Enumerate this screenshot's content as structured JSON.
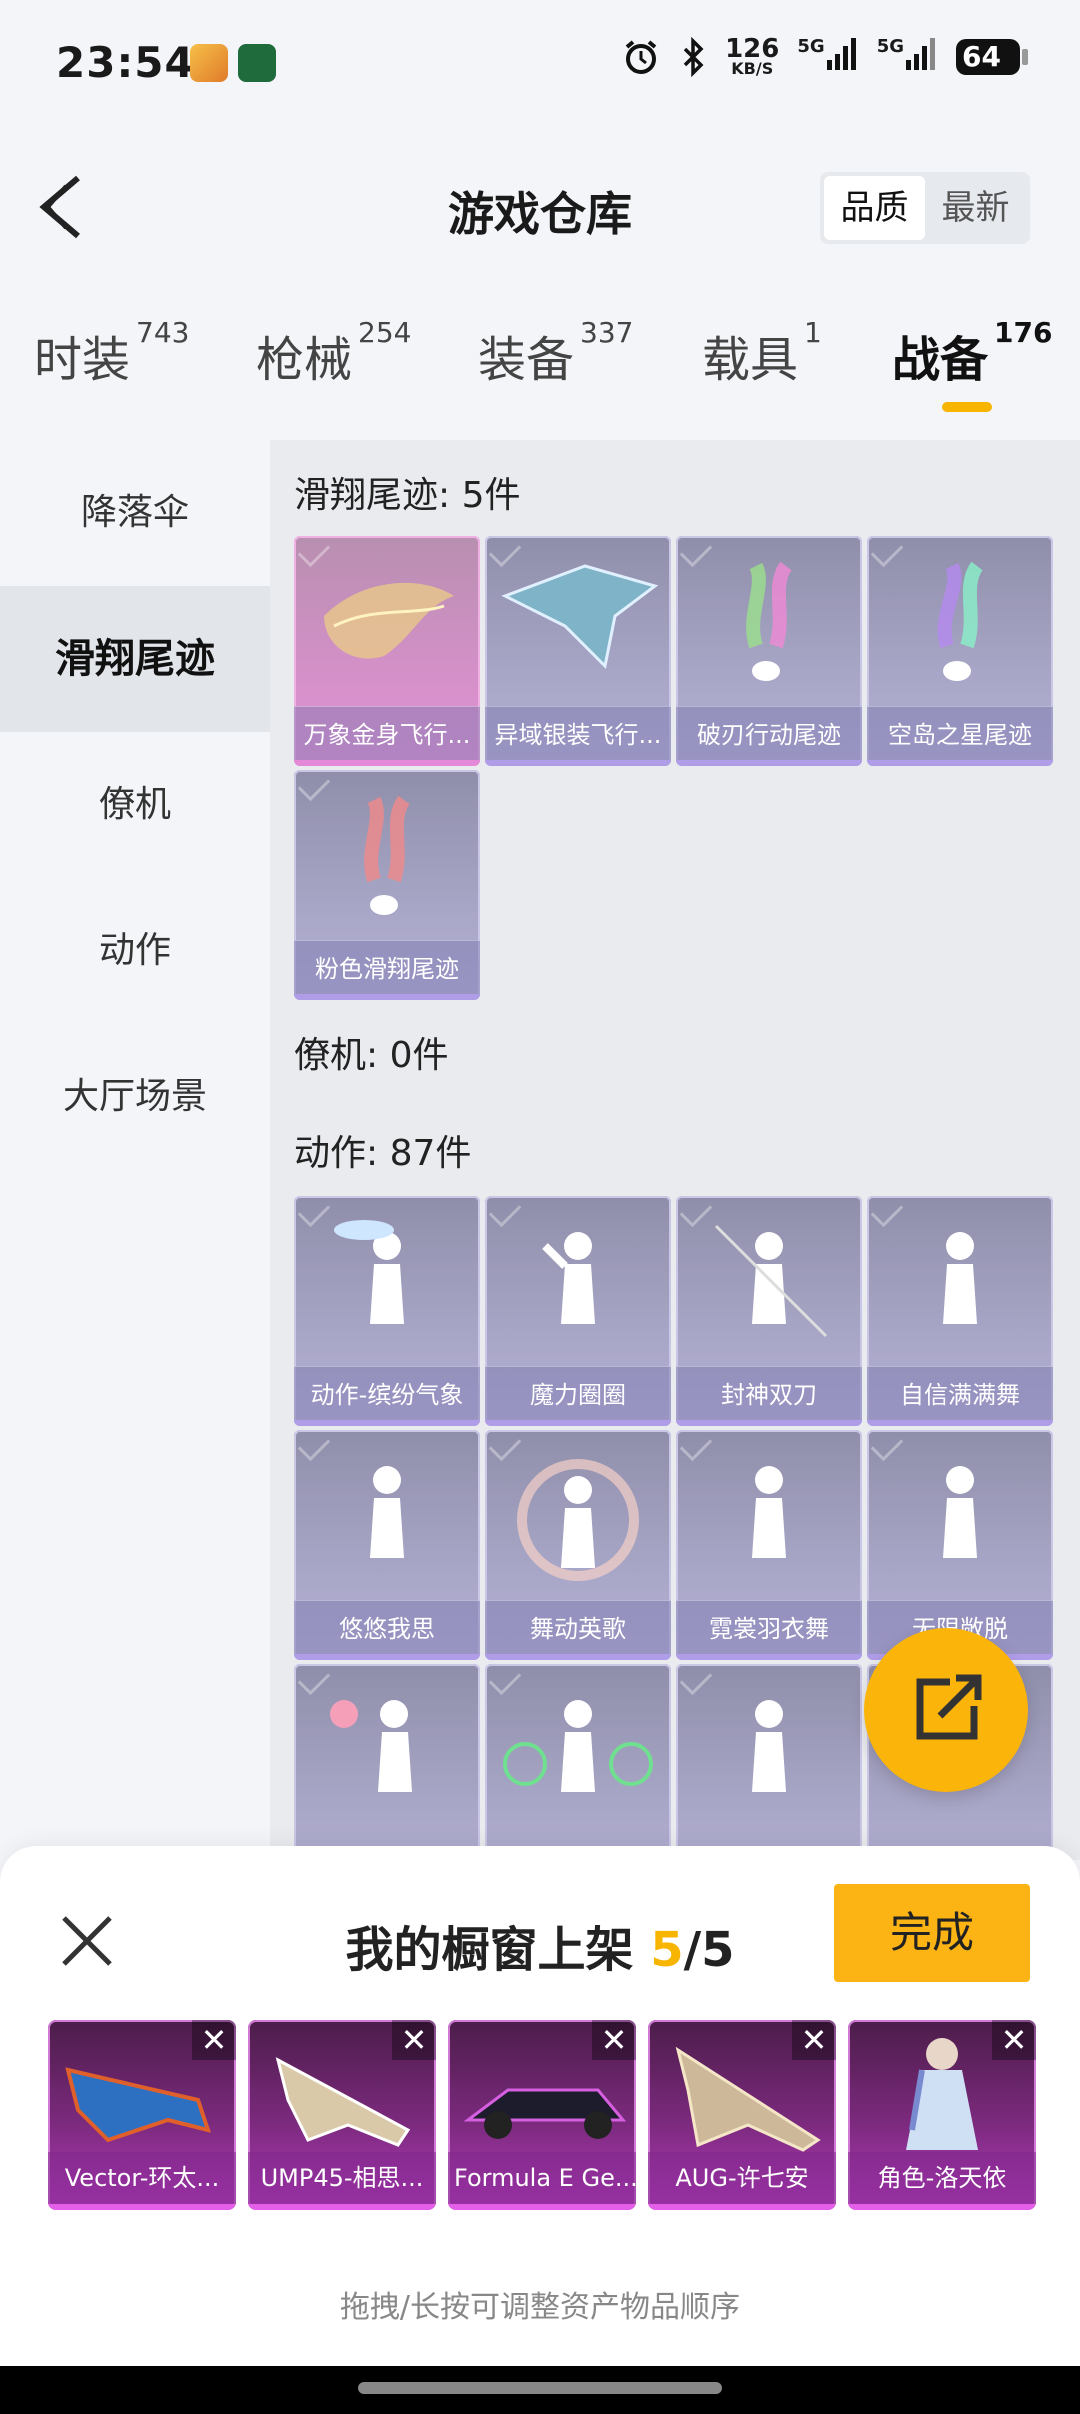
{
  "status_bar": {
    "time": "23:54",
    "net_speed_value": "126",
    "net_speed_unit": "KB/S",
    "sim1": "5G",
    "sim2": "5G",
    "battery": "64",
    "icons": [
      "alarm-icon",
      "bluetooth-icon",
      "signal-icon",
      "battery-icon"
    ]
  },
  "header": {
    "title": "游戏仓库",
    "sort_options": [
      {
        "label": "品质",
        "active": true
      },
      {
        "label": "最新",
        "active": false
      }
    ]
  },
  "category_tabs": [
    {
      "label": "时装",
      "count": "743",
      "active": false
    },
    {
      "label": "枪械",
      "count": "254",
      "active": false
    },
    {
      "label": "装备",
      "count": "337",
      "active": false
    },
    {
      "label": "载具",
      "count": "1",
      "active": false
    },
    {
      "label": "战备",
      "count": "176",
      "active": true
    }
  ],
  "side_nav": [
    {
      "label": "降落伞",
      "active": false
    },
    {
      "label": "滑翔尾迹",
      "active": true
    },
    {
      "label": "僚机",
      "active": false
    },
    {
      "label": "动作",
      "active": false
    },
    {
      "label": "大厅场景",
      "active": false
    }
  ],
  "sections": {
    "glide": {
      "title": "滑翔尾迹: 5件",
      "items": [
        "万象金身飞行...",
        "异域银装飞行...",
        "破刃行动尾迹",
        "空岛之星尾迹",
        "粉色滑翔尾迹"
      ]
    },
    "wingman": {
      "title": "僚机: 0件"
    },
    "emote": {
      "title": "动作: 87件",
      "items": [
        "动作-缤纷气象",
        "魔力圈圈",
        "封神双刀",
        "自信满满舞",
        "悠悠我思",
        "舞动英歌",
        "霓裳羽衣舞",
        "无限敞脱"
      ]
    }
  },
  "showcase": {
    "title_prefix": "我的橱窗上架",
    "count": "5",
    "sep": "/",
    "total": "5",
    "done_label": "完成",
    "items": [
      "Vector-环太...",
      "UMP45-相思...",
      "Formula E Ge...",
      "AUG-许七安",
      "角色-洛天依"
    ],
    "remove_label": "✕",
    "hint": "拖拽/长按可调整资产物品顺序"
  },
  "colors": {
    "accent": "#f7b500",
    "card_purple": "#a8a6c6",
    "card_pink": "#d490c8",
    "shelf_magenta": "#7c2a7e"
  }
}
